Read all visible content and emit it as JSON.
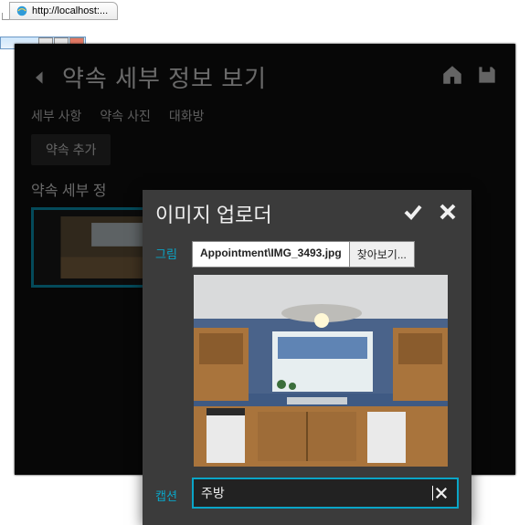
{
  "browser": {
    "url": "http://localhost:..."
  },
  "page": {
    "title": "약속 세부 정보 보기",
    "tabs": [
      "세부 사항",
      "약속 사진",
      "대화방"
    ],
    "add_chip": "약속 추가",
    "section": "약속 세부 정"
  },
  "modal": {
    "title": "이미지 업로더",
    "labels": {
      "image": "그림",
      "caption": "캡션"
    },
    "filepath": "Appointment\\IMG_3493.jpg",
    "browse": "찾아보기...",
    "caption_value": "주방"
  }
}
